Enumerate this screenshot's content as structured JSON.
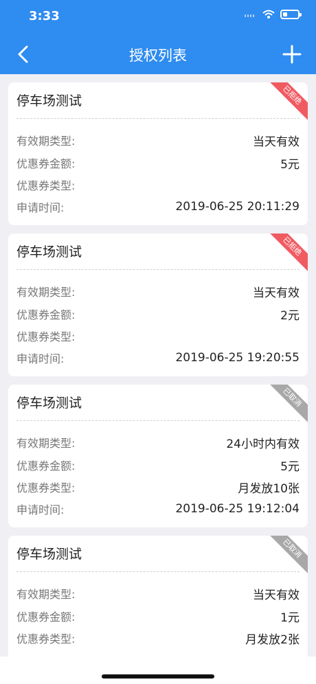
{
  "status_bar": {
    "time": "3:33",
    "battery_level": 0.3
  },
  "nav": {
    "title": "授权列表"
  },
  "cards": [
    {
      "name": "停车场测试",
      "status": "已拒绝",
      "fields": [
        {
          "label": "有效期类型:",
          "value": "当天有效"
        },
        {
          "label": "优惠券金额:",
          "value": "5元"
        },
        {
          "label": "优惠券类型:",
          "value": ""
        },
        {
          "label": "申请时间:",
          "value": "2019-06-25 20:11:29"
        }
      ]
    },
    {
      "name": "停车场测试",
      "status": "已拒绝",
      "fields": [
        {
          "label": "有效期类型:",
          "value": "当天有效"
        },
        {
          "label": "优惠券金额:",
          "value": "2元"
        },
        {
          "label": "优惠券类型:",
          "value": ""
        },
        {
          "label": "申请时间:",
          "value": "2019-06-25 19:20:55"
        }
      ]
    },
    {
      "name": "停车场测试",
      "status": "已取消",
      "fields": [
        {
          "label": "有效期类型:",
          "value": "24小时内有效"
        },
        {
          "label": "优惠券金额:",
          "value": "5元"
        },
        {
          "label": "优惠券类型:",
          "value": "月发放10张"
        },
        {
          "label": "申请时间:",
          "value": "2019-06-25 19:12:04"
        }
      ]
    },
    {
      "name": "停车场测试",
      "status": "已取消",
      "fields": [
        {
          "label": "有效期类型:",
          "value": "当天有效"
        },
        {
          "label": "优惠券金额:",
          "value": "1元"
        },
        {
          "label": "优惠券类型:",
          "value": "月发放2张"
        },
        {
          "label": "",
          "value": ""
        }
      ]
    }
  ],
  "colors": {
    "header": "#2f8cf0",
    "rejected": "#f05b62",
    "cancelled": "#a8a8a8"
  },
  "icons": {
    "back": "chevron-left-icon",
    "add": "plus-icon",
    "wifi": "wifi-icon",
    "battery": "battery-icon",
    "signal": "signal-icon"
  }
}
